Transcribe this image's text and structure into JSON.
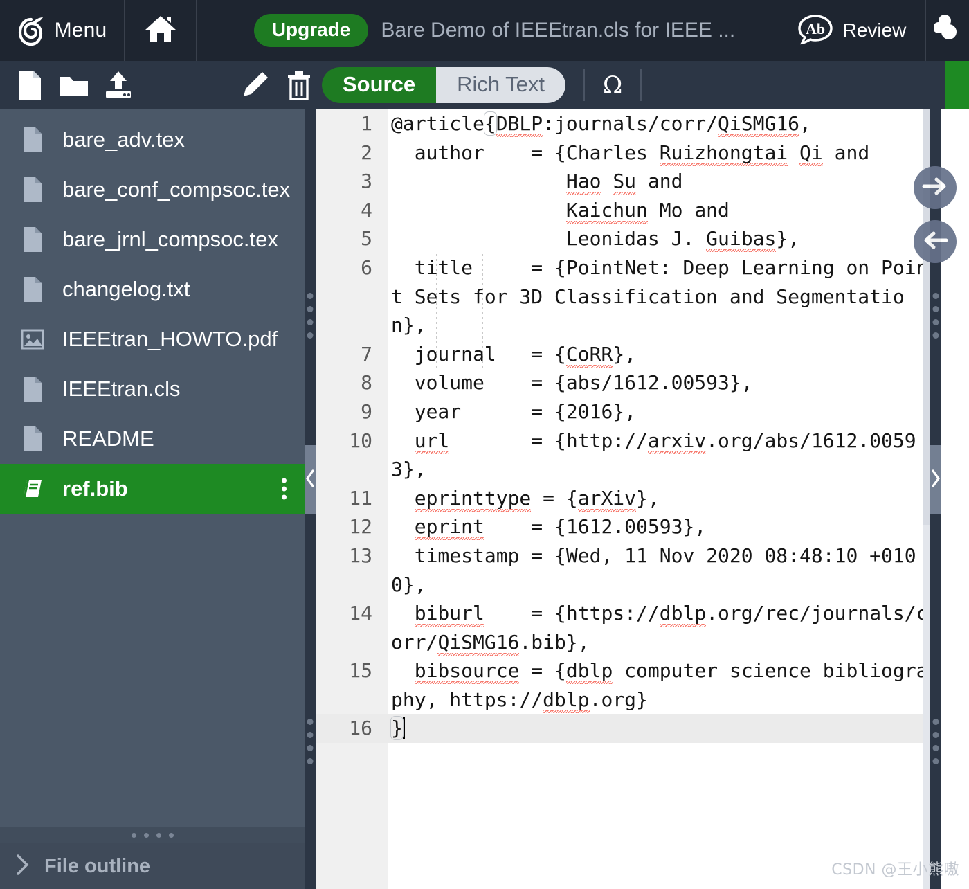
{
  "topnav": {
    "logo_icon": "overleaf-logo-icon",
    "menu_label": "Menu",
    "home_icon": "home-icon",
    "upgrade_label": "Upgrade",
    "doc_title": "Bare Demo of IEEEtran.cls for IEEE ...",
    "review_icon": "review-ab-icon",
    "review_label": "Review",
    "share_icon": "share-people-icon"
  },
  "toolbar": {
    "new_file_icon": "new-file-icon",
    "new_folder_icon": "new-folder-icon",
    "upload_icon": "upload-icon",
    "rename_icon": "pencil-icon",
    "delete_icon": "trash-icon",
    "source_label": "Source",
    "rich_text_label": "Rich Text",
    "symbols_icon": "omega-symbol-icon",
    "symbols_label": "Ω"
  },
  "sidebar": {
    "files": [
      {
        "name": "bare_adv.tex",
        "icon": "file-icon",
        "selected": false
      },
      {
        "name": "bare_conf_compsoc.tex",
        "icon": "file-icon",
        "selected": false
      },
      {
        "name": "bare_jrnl_compsoc.tex",
        "icon": "file-icon",
        "selected": false
      },
      {
        "name": "changelog.txt",
        "icon": "file-icon",
        "selected": false
      },
      {
        "name": "IEEEtran_HOWTO.pdf",
        "icon": "image-file-icon",
        "selected": false
      },
      {
        "name": "IEEEtran.cls",
        "icon": "file-icon",
        "selected": false
      },
      {
        "name": "README",
        "icon": "file-icon",
        "selected": false
      },
      {
        "name": "ref.bib",
        "icon": "bibliography-icon",
        "selected": true
      }
    ],
    "outline_label": "File outline",
    "outline_chevron": "chevron-right-icon"
  },
  "splitters": {
    "left_collapse_icon": "chevron-left-icon",
    "right_collapse_icon": "chevron-right-icon"
  },
  "editor": {
    "nav_forward_icon": "arrow-right-circle-icon",
    "nav_back_icon": "arrow-left-circle-icon",
    "active_line": 16,
    "lines": [
      {
        "n": 1,
        "text": "@article{DBLP:journals/corr/QiSMG16,"
      },
      {
        "n": 2,
        "text": "  author    = {Charles Ruizhongtai Qi and"
      },
      {
        "n": 3,
        "text": "               Hao Su and"
      },
      {
        "n": 4,
        "text": "               Kaichun Mo and"
      },
      {
        "n": 5,
        "text": "               Leonidas J. Guibas},"
      },
      {
        "n": 6,
        "text": "  title     = {PointNet: Deep Learning on Point Sets for 3D Classification and Segmentation},"
      },
      {
        "n": 7,
        "text": "  journal   = {CoRR},"
      },
      {
        "n": 8,
        "text": "  volume    = {abs/1612.00593},"
      },
      {
        "n": 9,
        "text": "  year      = {2016},"
      },
      {
        "n": 10,
        "text": "  url       = {http://arxiv.org/abs/1612.00593},"
      },
      {
        "n": 11,
        "text": "  eprinttype = {arXiv},"
      },
      {
        "n": 12,
        "text": "  eprint    = {1612.00593},"
      },
      {
        "n": 13,
        "text": "  timestamp = {Wed, 11 Nov 2020 08:48:10 +0100},"
      },
      {
        "n": 14,
        "text": "  biburl    = {https://dblp.org/rec/journals/corr/QiSMG16.bib},"
      },
      {
        "n": 15,
        "text": "  bibsource = {dblp computer science bibliography, https://dblp.org}"
      },
      {
        "n": 16,
        "text": "}"
      }
    ]
  },
  "watermark": "CSDN @王小熊嗷",
  "colors": {
    "nav_bg": "#1e2530",
    "toolbar_bg": "#2c3645",
    "sidebar_bg": "#4b5868",
    "accent_green": "#1e8a23",
    "upgrade_green": "#1e7b22",
    "spellcheck_red": "#f7776b",
    "title_text": "#a7b0bd"
  }
}
